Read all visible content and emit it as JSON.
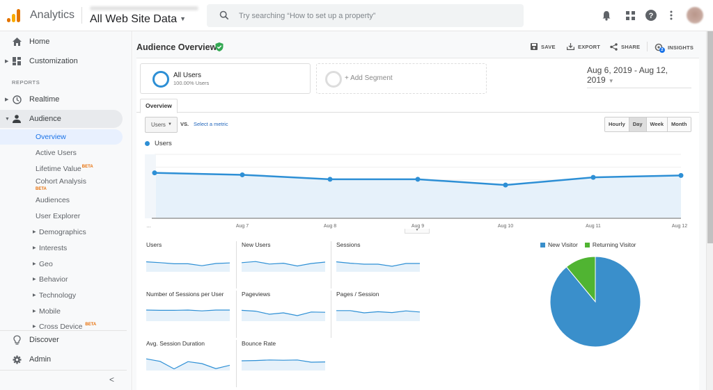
{
  "topbar": {
    "app_name": "Analytics",
    "property_selector": "All Web Site Data",
    "search_placeholder": "Try searching “How to set up a property”",
    "icons": [
      "bell-icon",
      "apps-grid-icon",
      "help-icon",
      "more-vert-icon",
      "avatar"
    ]
  },
  "sidebar": {
    "home": "Home",
    "customization": "Customization",
    "reports_heading": "REPORTS",
    "realtime": "Realtime",
    "audience": "Audience",
    "audience_items": [
      {
        "label": "Overview",
        "selected": true
      },
      {
        "label": "Active Users"
      },
      {
        "label": "Lifetime Value",
        "badge": "BETA"
      },
      {
        "label": "Cohort Analysis",
        "badge": "BETA"
      },
      {
        "label": "Audiences"
      },
      {
        "label": "User Explorer"
      },
      {
        "label": "Demographics",
        "expandable": true
      },
      {
        "label": "Interests",
        "expandable": true
      },
      {
        "label": "Geo",
        "expandable": true
      },
      {
        "label": "Behavior",
        "expandable": true
      },
      {
        "label": "Technology",
        "expandable": true
      },
      {
        "label": "Mobile",
        "expandable": true
      },
      {
        "label": "Cross Device",
        "expandable": true,
        "badge": "BETA"
      }
    ],
    "discover": "Discover",
    "admin": "Admin"
  },
  "page": {
    "title": "Audience Overview",
    "actions": {
      "save": "SAVE",
      "export": "EXPORT",
      "share": "SHARE",
      "insights": "INSIGHTS",
      "insights_badge": "2"
    },
    "segments": {
      "all_users": "All Users",
      "all_users_sub": "100.00% Users",
      "add_segment": "+ Add Segment"
    },
    "date_range": "Aug 6, 2019 - Aug 12, 2019",
    "tab": "Overview",
    "metric_select": "Users",
    "vs": "VS.",
    "select_metric": "Select a metric",
    "granularity": [
      {
        "label": "Hourly",
        "active": false
      },
      {
        "label": "Day",
        "active": true
      },
      {
        "label": "Week",
        "active": false
      },
      {
        "label": "Month",
        "active": false
      }
    ]
  },
  "colors": {
    "series": "#2d8fd5",
    "fill": "#e6f1fa",
    "new_visitor": "#3a8fcb",
    "returning_visitor": "#50b432",
    "beta": "#e8710a"
  },
  "chart_data": [
    {
      "type": "area",
      "title": "Users",
      "legend": [
        "Users"
      ],
      "x": [
        "…",
        "Aug 7",
        "Aug 8",
        "Aug 9",
        "Aug 10",
        "Aug 11",
        "Aug 12"
      ],
      "dates": [
        "Aug 6",
        "Aug 7",
        "Aug 8",
        "Aug 9",
        "Aug 10",
        "Aug 11",
        "Aug 12"
      ],
      "values": [
        0.71,
        0.68,
        0.61,
        0.61,
        0.52,
        0.64,
        0.67
      ],
      "ylim": [
        0,
        1
      ],
      "ylabel": "",
      "note": "y-axis tick labels are obscured; values are relative (fraction of y-range)",
      "grid": true
    },
    {
      "type": "pie",
      "legend": [
        "New Visitor",
        "Returning Visitor"
      ],
      "values": [
        89,
        11
      ],
      "legend_position": "top"
    }
  ],
  "sparklines": [
    {
      "label": "Users",
      "values": [
        0.72,
        0.66,
        0.58,
        0.58,
        0.44,
        0.6,
        0.64
      ]
    },
    {
      "label": "New Users",
      "values": [
        0.66,
        0.74,
        0.56,
        0.62,
        0.42,
        0.6,
        0.7
      ]
    },
    {
      "label": "Sessions",
      "values": [
        0.72,
        0.62,
        0.55,
        0.55,
        0.4,
        0.6,
        0.6
      ]
    },
    {
      "label": "Number of Sessions per User",
      "values": [
        0.8,
        0.78,
        0.78,
        0.8,
        0.74,
        0.8,
        0.8
      ]
    },
    {
      "label": "Pageviews",
      "values": [
        0.78,
        0.72,
        0.5,
        0.6,
        0.4,
        0.66,
        0.64
      ]
    },
    {
      "label": "Pages / Session",
      "values": [
        0.76,
        0.76,
        0.6,
        0.68,
        0.62,
        0.74,
        0.66
      ]
    },
    {
      "label": "Avg. Session Duration",
      "values": [
        0.84,
        0.66,
        0.12,
        0.64,
        0.5,
        0.14,
        0.38
      ]
    },
    {
      "label": "Bounce Rate",
      "values": [
        0.7,
        0.72,
        0.76,
        0.74,
        0.76,
        0.6,
        0.62
      ]
    }
  ]
}
